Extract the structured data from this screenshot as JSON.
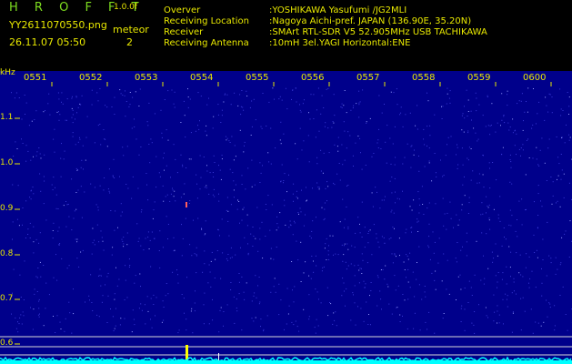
{
  "header": {
    "app_title": "H R O F F T",
    "version": "1.0.0f",
    "file_name": "YY2611070550.png",
    "meteor_label": "meteor",
    "meteor_count": "2",
    "timestamp": "26.11.07 05:50"
  },
  "info": [
    {
      "key": "Overver",
      "value": ":YOSHIKAWA Yasufumi /JG2MLI"
    },
    {
      "key": "Receiving Location",
      "value": ":Nagoya Aichi-pref. JAPAN (136.90E, 35.20N)"
    },
    {
      "key": "Receiver",
      "value": ":SMArt RTL-SDR V5 52.905MHz USB TACHIKAWA"
    },
    {
      "key": "Receiving Antenna",
      "value": ":10mH 3el.YAGI Horizontal:ENE"
    }
  ],
  "axis": {
    "unit": "kHz",
    "y_ticks": [
      "1.1",
      "1.0",
      "0.9",
      "0.8",
      "0.7",
      "0.6"
    ],
    "x_ticks": [
      "0551",
      "0552",
      "0553",
      "0554",
      "0555",
      "0556",
      "0557",
      "0558",
      "0559",
      "0600"
    ]
  },
  "colors": {
    "background": "#00008b",
    "text": "#e8e800",
    "title": "#7ddc1f",
    "signal": "#00ffff"
  }
}
